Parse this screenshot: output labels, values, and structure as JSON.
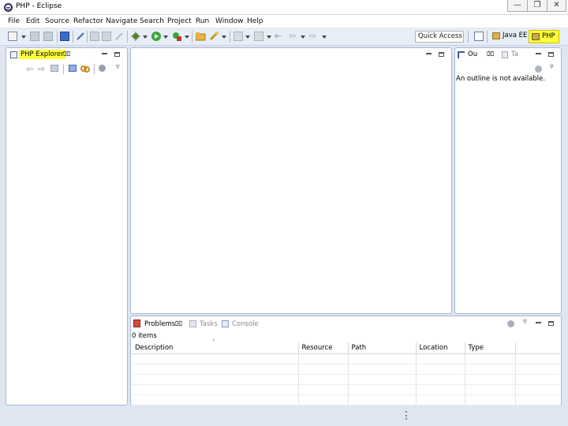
{
  "window": {
    "title": "PHP - Eclipse"
  },
  "menu": [
    "File",
    "Edit",
    "Source",
    "Refactor",
    "Navigate",
    "Search",
    "Project",
    "Run",
    "Window",
    "Help"
  ],
  "toolbar": {
    "quick_access": "Quick Access"
  },
  "perspectives": {
    "java_ee": "Java EE",
    "php": "PHP"
  },
  "explorer": {
    "tab_label": "PHP Explorer"
  },
  "outline": {
    "tab_label": "Ou",
    "tasks_tab_label": "Ta",
    "message": "An outline is not available."
  },
  "bottom": {
    "tabs": {
      "problems": "Problems",
      "tasks": "Tasks",
      "console": "Console"
    },
    "item_count": "0 items",
    "columns": [
      "Description",
      "Resource",
      "Path",
      "Location",
      "Type"
    ]
  },
  "colors": {
    "highlight": "#ffff3a",
    "panel_border": "#a8b8d0",
    "chrome_bg": "#dfe6f1"
  }
}
